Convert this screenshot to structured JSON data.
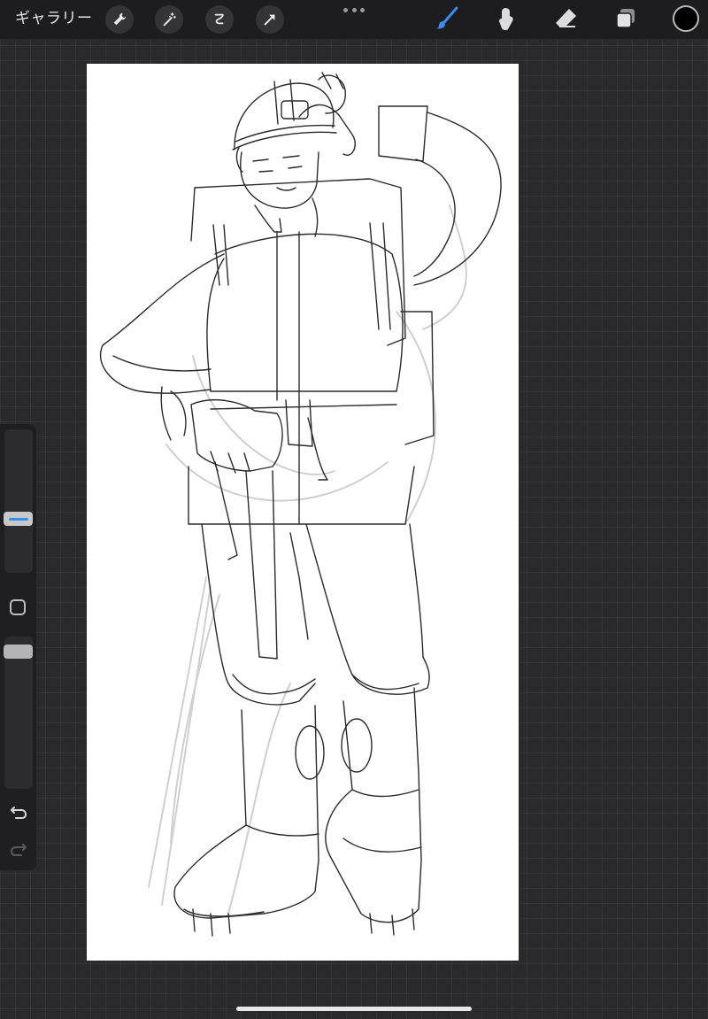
{
  "topbar": {
    "gallery_label": "ギャラリー",
    "actions": [
      {
        "icon": "wrench-icon"
      },
      {
        "icon": "magic-wand-icon"
      },
      {
        "icon": "selection-icon"
      },
      {
        "icon": "transform-arrow-icon"
      }
    ],
    "right_tools": [
      {
        "icon": "brush-icon",
        "active": true
      },
      {
        "icon": "smudge-icon",
        "active": false
      },
      {
        "icon": "eraser-icon",
        "active": false
      },
      {
        "icon": "layers-icon",
        "active": false
      }
    ],
    "current_color": "#000000",
    "accent_color": "#3a8df5"
  },
  "sidebar": {
    "brush_size_level": 0.57,
    "opacity_level": 0.95,
    "icons": [
      "square-modify-icon",
      "undo-icon",
      "redo-icon"
    ]
  },
  "canvas": {
    "artwork": "line-sketch"
  }
}
